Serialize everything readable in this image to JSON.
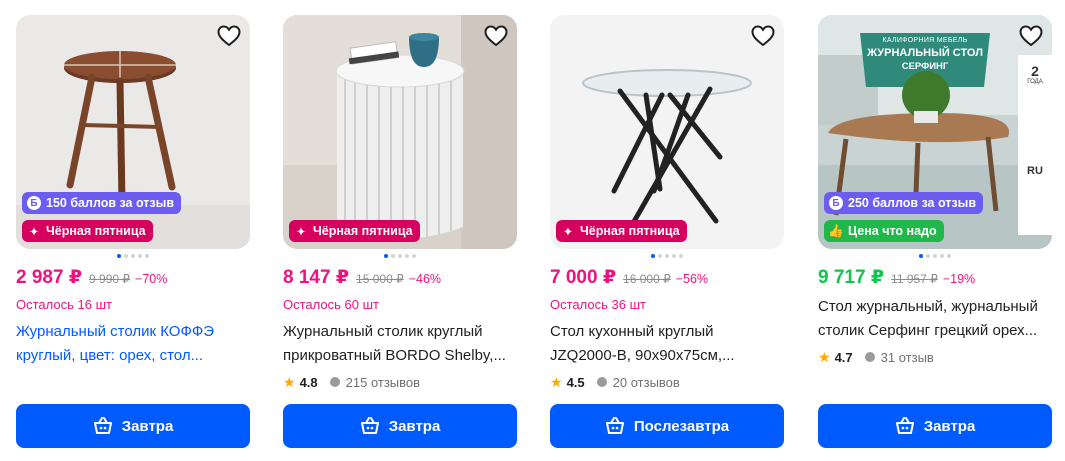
{
  "colors": {
    "accent": "#005bff",
    "sale": "#f1117e",
    "good_price": "#10c44c",
    "points_badge": "#6c5cf0",
    "friday_badge": "#d6005e",
    "good_badge": "#20b84b"
  },
  "products": [
    {
      "price": "2 987 ₽",
      "old_price": "9 990 ₽",
      "discount": "−70%",
      "stock": "Осталось 16 шт",
      "title": "Журнальный столик КОФФЭ круглый, цвет: орех, стол...",
      "points_badge": "150 баллов за отзыв",
      "promo_badge": "Чёрная пятница",
      "buy_label": "Завтра",
      "dots": 5,
      "active_dot": 0
    },
    {
      "price": "8 147 ₽",
      "old_price": "15 000 ₽",
      "discount": "−46%",
      "stock": "Осталось 60 шт",
      "title": "Журнальный столик круглый прикроватный BORDO Shelby,...",
      "promo_badge": "Чёрная пятница",
      "rating": "4.8",
      "reviews": "215 отзывов",
      "buy_label": "Завтра",
      "dots": 5,
      "active_dot": 0
    },
    {
      "price": "7 000 ₽",
      "old_price": "16 000 ₽",
      "discount": "−56%",
      "stock": "Осталось 36 шт",
      "title": "Стол кухонный круглый JZQ2000-B, 90x90x75см,...",
      "promo_badge": "Чёрная пятница",
      "rating": "4.5",
      "reviews": "20 отзывов",
      "buy_label": "Послезавтра",
      "dots": 5,
      "active_dot": 0
    },
    {
      "price": "9 717 ₽",
      "old_price": "11 957 ₽",
      "discount": "−19%",
      "title": "Стол журнальный, журнальный столик Серфинг грецкий орех...",
      "points_badge": "250 баллов за отзыв",
      "promo_badge": "Цена что надо",
      "rating": "4.7",
      "reviews": "31 отзыв",
      "buy_label": "Завтра",
      "dots": 5,
      "active_dot": 0,
      "photo_text": {
        "brand": "КАЛИФОРНИЯ МЕБЕЛЬ",
        "headline_1": "ЖУРНАЛЬНЫЙ СТОЛ",
        "headline_2": "СЕРФИНГ",
        "warranty_num": "2",
        "warranty_text": "ГОДА",
        "country": "RU"
      }
    }
  ]
}
